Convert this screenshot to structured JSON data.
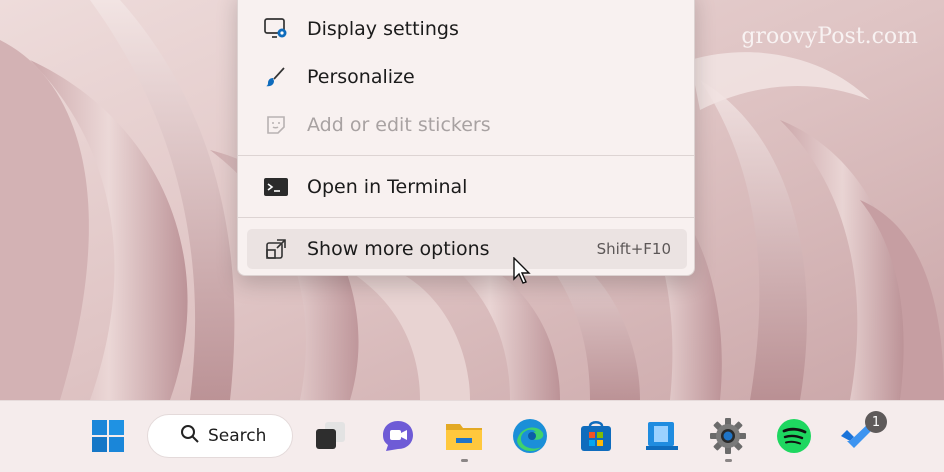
{
  "watermark": "groovyPost.com",
  "context_menu": {
    "items": [
      {
        "label": "Display settings",
        "icon": "display-settings-icon",
        "enabled": true
      },
      {
        "label": "Personalize",
        "icon": "brush-icon",
        "enabled": true
      },
      {
        "label": "Add or edit stickers",
        "icon": "sticker-icon",
        "enabled": false
      },
      {
        "label": "Open in Terminal",
        "icon": "terminal-icon",
        "enabled": true
      },
      {
        "label": "Show more options",
        "icon": "open-external-icon",
        "enabled": true,
        "shortcut": "Shift+F10"
      }
    ]
  },
  "taskbar": {
    "search_label": "Search",
    "apps": [
      {
        "name": "start",
        "icon": "windows-logo-icon"
      },
      {
        "name": "task-view",
        "icon": "task-view-icon"
      },
      {
        "name": "chat",
        "icon": "chat-icon"
      },
      {
        "name": "file-explorer",
        "icon": "folder-icon",
        "running": true
      },
      {
        "name": "edge",
        "icon": "edge-icon"
      },
      {
        "name": "store",
        "icon": "store-icon"
      },
      {
        "name": "app",
        "icon": "app-icon"
      },
      {
        "name": "settings",
        "icon": "gear-icon",
        "running": true
      },
      {
        "name": "spotify",
        "icon": "spotify-icon"
      },
      {
        "name": "todo",
        "icon": "todo-icon",
        "badge": "1"
      }
    ]
  },
  "colors": {
    "menu_bg": "#f8f1f0",
    "hover_bg": "#ebe3e2",
    "taskbar_bg": "#f5ecec",
    "accent_blue": "#0f6cbd"
  }
}
